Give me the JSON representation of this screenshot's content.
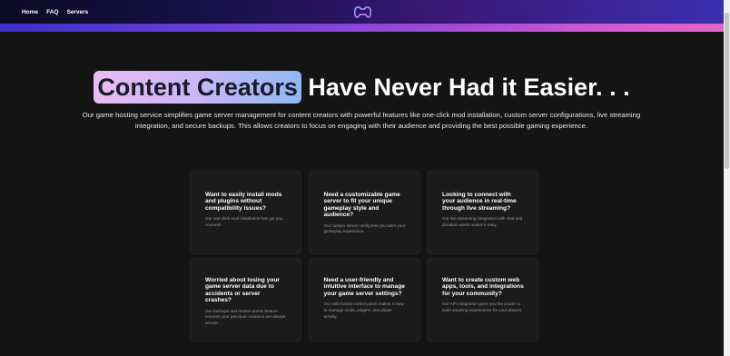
{
  "nav": {
    "items": [
      {
        "label": "Home"
      },
      {
        "label": "FAQ"
      },
      {
        "label": "Servers"
      }
    ],
    "logo_icon": "gamepad-icon"
  },
  "hero": {
    "highlight": "Content Creators",
    "title_rest": "Have Never Had it Easier. . .",
    "description": "Our game hosting service simplifies game server management for content creators with powerful features like one-click mod installation, custom server configurations, live streaming integration, and secure backups. This allows creators to focus on engaging with their audience and providing the best possible gaming experience."
  },
  "cards": [
    {
      "title": "Want to easily install mods and plugins without compatibility issues?",
      "body": "Our one-click mod installation has got you covered!"
    },
    {
      "title": "Need a customizable game server to fit your unique gameplay style and audience?",
      "body": "Our custom server config lets you tailor your gameplay experience."
    },
    {
      "title": "Looking to connect with your audience in real-time through live streaming?",
      "body": "Our live streaming integration with chat and donation alerts makes it easy."
    },
    {
      "title": "Worried about losing your game server data due to accidents or server crashes?",
      "body": "Our backups and restore points feature ensures your precious creations are always secure."
    },
    {
      "title": "Need a user-friendly and intuitive interface to manage your game server settings?",
      "body": "Our web-based control panel makes it easy to manage mods, plugins, and player activity."
    },
    {
      "title": "Want to create custom web apps, tools, and integrations for your community?",
      "body": "Our API integration gives you the power to build amazing experiences for your players."
    }
  ],
  "colors": {
    "background": "#141414",
    "card": "#1b1b1b",
    "accent_start": "#3b2fc9",
    "accent_end": "#e067c6"
  }
}
